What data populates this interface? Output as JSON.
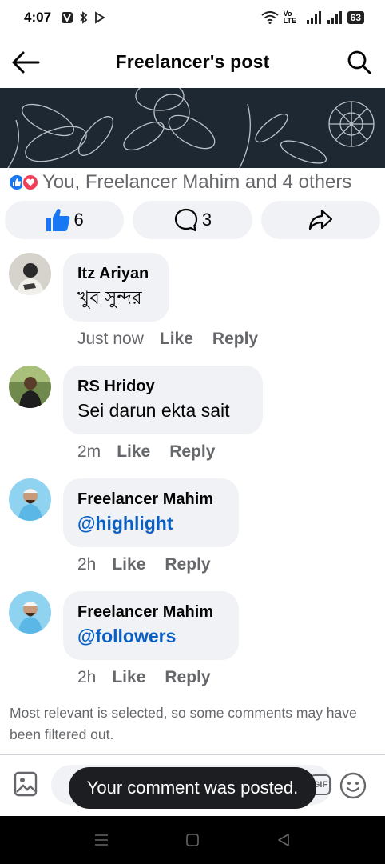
{
  "status_bar": {
    "time": "4:07",
    "network": "Vo LTE",
    "battery": "63"
  },
  "header": {
    "title": "Freelancer's post"
  },
  "reactions": {
    "summary": "You, Freelancer Mahim and 4 others"
  },
  "actions": {
    "like_count": "6",
    "comment_count": "3"
  },
  "comments": [
    {
      "author": "Itz Ariyan",
      "text": "খুব সুন্দর",
      "time": "Just now",
      "like_label": "Like",
      "reply_label": "Reply"
    },
    {
      "author": "RS Hridoy",
      "text": "Sei darun ekta sait",
      "time": "2m",
      "like_label": "Like",
      "reply_label": "Reply"
    },
    {
      "author": "Freelancer Mahim",
      "text": "@highlight",
      "time": "2h",
      "like_label": "Like",
      "reply_label": "Reply"
    },
    {
      "author": "Freelancer Mahim",
      "text": "@followers",
      "time": "2h",
      "like_label": "Like",
      "reply_label": "Reply"
    }
  ],
  "filter_note": "Most relevant is selected, so some comments may have been filtered out.",
  "composer": {
    "gif_label": "GIF"
  },
  "toast": "Your comment was posted.",
  "colors": {
    "like_blue": "#1877f2",
    "love_red": "#f33e58",
    "mention_blue": "#0a5fc2",
    "bubble_bg": "#f0f2f5"
  },
  "icons": [
    "back-arrow-icon",
    "search-icon",
    "like-icon",
    "comment-icon",
    "share-icon",
    "photo-icon",
    "gif-icon",
    "emoji-icon"
  ]
}
